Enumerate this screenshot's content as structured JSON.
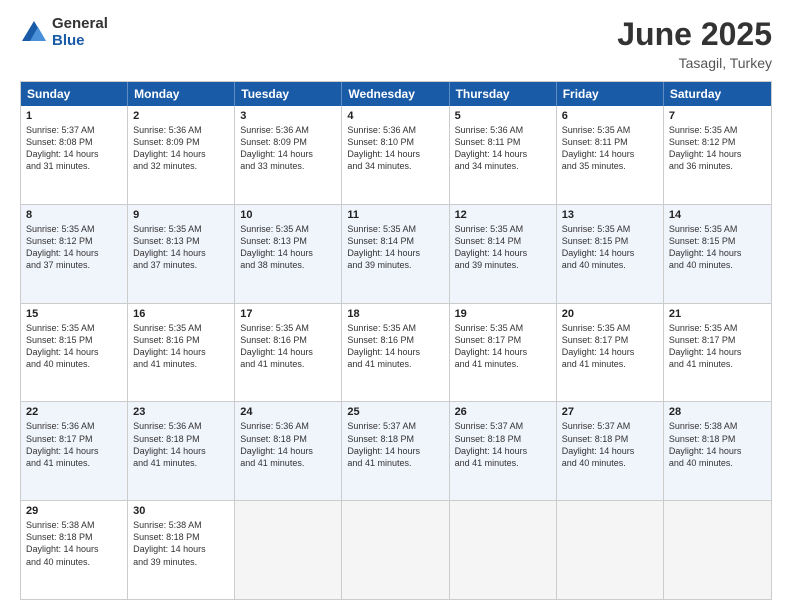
{
  "logo": {
    "general": "General",
    "blue": "Blue"
  },
  "title": {
    "month": "June 2025",
    "location": "Tasagil, Turkey"
  },
  "header_days": [
    "Sunday",
    "Monday",
    "Tuesday",
    "Wednesday",
    "Thursday",
    "Friday",
    "Saturday"
  ],
  "weeks": [
    [
      {
        "day": "1",
        "info": "Sunrise: 5:37 AM\nSunset: 8:08 PM\nDaylight: 14 hours\nand 31 minutes."
      },
      {
        "day": "2",
        "info": "Sunrise: 5:36 AM\nSunset: 8:09 PM\nDaylight: 14 hours\nand 32 minutes."
      },
      {
        "day": "3",
        "info": "Sunrise: 5:36 AM\nSunset: 8:09 PM\nDaylight: 14 hours\nand 33 minutes."
      },
      {
        "day": "4",
        "info": "Sunrise: 5:36 AM\nSunset: 8:10 PM\nDaylight: 14 hours\nand 34 minutes."
      },
      {
        "day": "5",
        "info": "Sunrise: 5:36 AM\nSunset: 8:11 PM\nDaylight: 14 hours\nand 34 minutes."
      },
      {
        "day": "6",
        "info": "Sunrise: 5:35 AM\nSunset: 8:11 PM\nDaylight: 14 hours\nand 35 minutes."
      },
      {
        "day": "7",
        "info": "Sunrise: 5:35 AM\nSunset: 8:12 PM\nDaylight: 14 hours\nand 36 minutes."
      }
    ],
    [
      {
        "day": "8",
        "info": "Sunrise: 5:35 AM\nSunset: 8:12 PM\nDaylight: 14 hours\nand 37 minutes."
      },
      {
        "day": "9",
        "info": "Sunrise: 5:35 AM\nSunset: 8:13 PM\nDaylight: 14 hours\nand 37 minutes."
      },
      {
        "day": "10",
        "info": "Sunrise: 5:35 AM\nSunset: 8:13 PM\nDaylight: 14 hours\nand 38 minutes."
      },
      {
        "day": "11",
        "info": "Sunrise: 5:35 AM\nSunset: 8:14 PM\nDaylight: 14 hours\nand 39 minutes."
      },
      {
        "day": "12",
        "info": "Sunrise: 5:35 AM\nSunset: 8:14 PM\nDaylight: 14 hours\nand 39 minutes."
      },
      {
        "day": "13",
        "info": "Sunrise: 5:35 AM\nSunset: 8:15 PM\nDaylight: 14 hours\nand 40 minutes."
      },
      {
        "day": "14",
        "info": "Sunrise: 5:35 AM\nSunset: 8:15 PM\nDaylight: 14 hours\nand 40 minutes."
      }
    ],
    [
      {
        "day": "15",
        "info": "Sunrise: 5:35 AM\nSunset: 8:15 PM\nDaylight: 14 hours\nand 40 minutes."
      },
      {
        "day": "16",
        "info": "Sunrise: 5:35 AM\nSunset: 8:16 PM\nDaylight: 14 hours\nand 41 minutes."
      },
      {
        "day": "17",
        "info": "Sunrise: 5:35 AM\nSunset: 8:16 PM\nDaylight: 14 hours\nand 41 minutes."
      },
      {
        "day": "18",
        "info": "Sunrise: 5:35 AM\nSunset: 8:16 PM\nDaylight: 14 hours\nand 41 minutes."
      },
      {
        "day": "19",
        "info": "Sunrise: 5:35 AM\nSunset: 8:17 PM\nDaylight: 14 hours\nand 41 minutes."
      },
      {
        "day": "20",
        "info": "Sunrise: 5:35 AM\nSunset: 8:17 PM\nDaylight: 14 hours\nand 41 minutes."
      },
      {
        "day": "21",
        "info": "Sunrise: 5:35 AM\nSunset: 8:17 PM\nDaylight: 14 hours\nand 41 minutes."
      }
    ],
    [
      {
        "day": "22",
        "info": "Sunrise: 5:36 AM\nSunset: 8:17 PM\nDaylight: 14 hours\nand 41 minutes."
      },
      {
        "day": "23",
        "info": "Sunrise: 5:36 AM\nSunset: 8:18 PM\nDaylight: 14 hours\nand 41 minutes."
      },
      {
        "day": "24",
        "info": "Sunrise: 5:36 AM\nSunset: 8:18 PM\nDaylight: 14 hours\nand 41 minutes."
      },
      {
        "day": "25",
        "info": "Sunrise: 5:37 AM\nSunset: 8:18 PM\nDaylight: 14 hours\nand 41 minutes."
      },
      {
        "day": "26",
        "info": "Sunrise: 5:37 AM\nSunset: 8:18 PM\nDaylight: 14 hours\nand 41 minutes."
      },
      {
        "day": "27",
        "info": "Sunrise: 5:37 AM\nSunset: 8:18 PM\nDaylight: 14 hours\nand 40 minutes."
      },
      {
        "day": "28",
        "info": "Sunrise: 5:38 AM\nSunset: 8:18 PM\nDaylight: 14 hours\nand 40 minutes."
      }
    ],
    [
      {
        "day": "29",
        "info": "Sunrise: 5:38 AM\nSunset: 8:18 PM\nDaylight: 14 hours\nand 40 minutes."
      },
      {
        "day": "30",
        "info": "Sunrise: 5:38 AM\nSunset: 8:18 PM\nDaylight: 14 hours\nand 39 minutes."
      },
      {
        "day": "",
        "info": ""
      },
      {
        "day": "",
        "info": ""
      },
      {
        "day": "",
        "info": ""
      },
      {
        "day": "",
        "info": ""
      },
      {
        "day": "",
        "info": ""
      }
    ]
  ]
}
